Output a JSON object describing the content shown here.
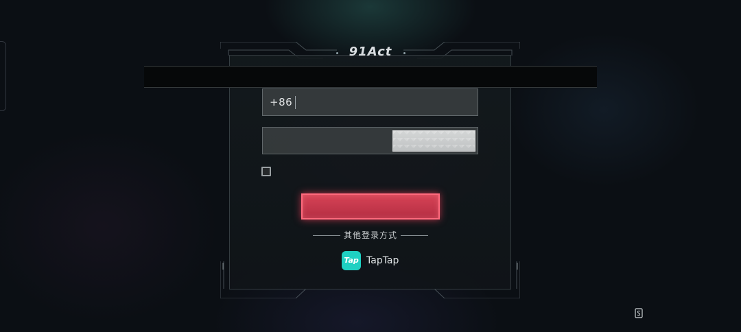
{
  "app": {
    "logo_text": "91Act"
  },
  "login": {
    "phone_prefix": "+86",
    "phone_value": "",
    "code_value": ""
  },
  "alt_login": {
    "divider_text": "其他登录方式",
    "taptap_icon_text": "Tap",
    "taptap_label": "TapTap"
  },
  "colors": {
    "accent_red": "#d64356",
    "taptap_teal": "#1fd0c2"
  }
}
